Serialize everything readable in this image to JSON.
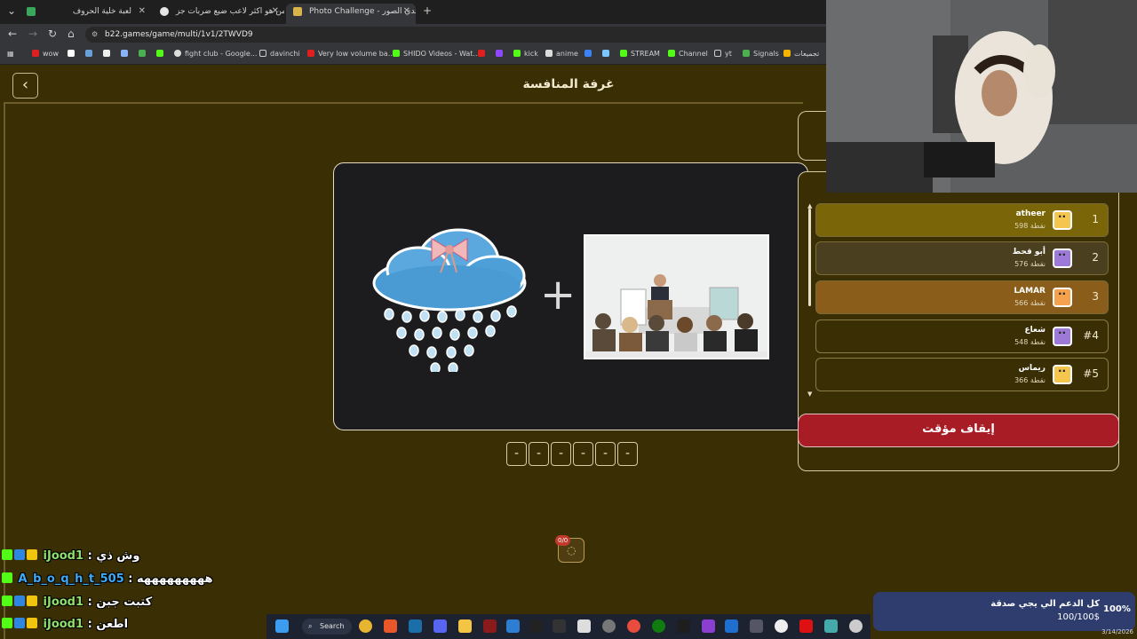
{
  "browser": {
    "tabs": [
      {
        "label": "لعبة خلية الحروف",
        "active": false
      },
      {
        "label": "من هو اكثر لاعب ضيع ضربات جز",
        "active": false
      },
      {
        "label": "Photo Challenge - تحدي الصور",
        "active": true
      }
    ],
    "new_tab": "+",
    "url": "b22.games/game/multi/1v1/2TWVD9",
    "bookmarks": [
      "wow",
      "fight club - Google...",
      "davinchi",
      "Very low volume ba...",
      "SHIDO Videos - Wat...",
      "kick",
      "anime",
      "STREAM",
      "Channel",
      "yt",
      "Signals",
      "تجميعات"
    ]
  },
  "game": {
    "back_glyph": "‹",
    "title": "غرفة المنافسة",
    "plus_glyph": "+",
    "slots": [
      "-",
      "-",
      "-",
      "-",
      "-",
      "-"
    ],
    "hint_badge": "0/0",
    "pause_button": "إيقاف مؤقت"
  },
  "leaderboard": [
    {
      "rank": "1",
      "name": "atheer",
      "points": "598 نقطة",
      "color": "#7a6608"
    },
    {
      "rank": "2",
      "name": "أبو قحط",
      "points": "576 نقطة",
      "color": "#4a3f1f"
    },
    {
      "rank": "3",
      "name": "LAMAR",
      "points": "566 نقطة",
      "color": "#8a5e1a"
    },
    {
      "rank": "#4",
      "name": "شعاع",
      "points": "548 نقطة",
      "color": "#3a2e05"
    },
    {
      "rank": "#5",
      "name": "ريماس",
      "points": "366 نقطة",
      "color": "#3a2e05"
    }
  ],
  "chat": [
    {
      "user": "iJood1",
      "message": "وش ذي",
      "user_color": "#8fe06a"
    },
    {
      "user": "A_b_o_q_h_t_505",
      "message": "هههههههههه",
      "user_color": "#3fa9f5"
    },
    {
      "user": "iJood1",
      "message": "كتبت جبن",
      "user_color": "#8fe06a"
    },
    {
      "user": "iJood1",
      "message": "اطعن",
      "user_color": "#8fe06a"
    }
  ],
  "taskbar": {
    "search_label": "Search"
  },
  "donation": {
    "message": "كل الدعم الي يجي صدقة",
    "amount": "100/100$",
    "percent": "100%",
    "progress": 1.0
  },
  "clock": {
    "date": "3/14/2026"
  }
}
